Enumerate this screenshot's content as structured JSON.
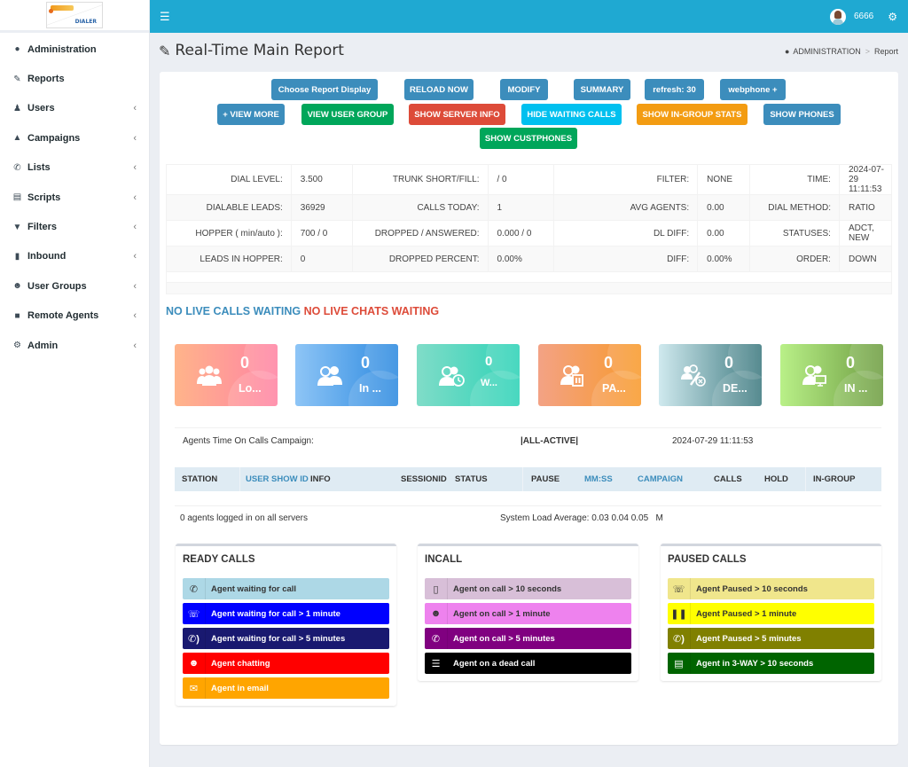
{
  "app": {
    "logo_text": "DIALER",
    "user": "6666"
  },
  "sidebar": {
    "items": [
      {
        "label": "Administration",
        "icon": "dashboard-icon",
        "has_submenu": false
      },
      {
        "label": "Reports",
        "icon": "edit-icon",
        "has_submenu": false
      },
      {
        "label": "Users",
        "icon": "user-icon",
        "has_submenu": true
      },
      {
        "label": "Campaigns",
        "icon": "bullhorn-icon",
        "has_submenu": true
      },
      {
        "label": "Lists",
        "icon": "phone-icon",
        "has_submenu": true
      },
      {
        "label": "Scripts",
        "icon": "file-text-icon",
        "has_submenu": true
      },
      {
        "label": "Filters",
        "icon": "filter-icon",
        "has_submenu": true
      },
      {
        "label": "Inbound",
        "icon": "bar-chart-icon",
        "has_submenu": true
      },
      {
        "label": "User Groups",
        "icon": "users-icon",
        "has_submenu": true
      },
      {
        "label": "Remote Agents",
        "icon": "lock-icon",
        "has_submenu": true
      },
      {
        "label": "Admin",
        "icon": "cog-icon",
        "has_submenu": true
      }
    ]
  },
  "header": {
    "title": "Real-Time Main Report",
    "breadcrumb": [
      "ADMINISTRATION",
      "Report"
    ]
  },
  "buttons": {
    "choose_report": "Choose Report Display",
    "reload": "RELOAD NOW",
    "modify": "MODIFY",
    "summary": "SUMMARY",
    "refresh": "refresh: 30",
    "webphone": "webphone +",
    "view_more": "+ VIEW MORE",
    "view_user_group": "VIEW USER GROUP",
    "show_server_info": "SHOW SERVER INFO",
    "hide_waiting_calls": "HIDE WAITING CALLS",
    "show_ingroup_stats": "SHOW IN-GROUP STATS",
    "show_phones": "SHOW PHONES",
    "show_custphones": "SHOW CUSTPHONES"
  },
  "stats": {
    "rows": [
      [
        {
          "k": "DIAL LEVEL:",
          "v": "3.500"
        },
        {
          "k": "TRUNK SHORT/FILL:",
          "v": "/ 0"
        },
        {
          "k": "FILTER:",
          "v": "NONE"
        },
        {
          "k": "TIME:",
          "v": "2024-07-29 11:11:53"
        }
      ],
      [
        {
          "k": "DIALABLE LEADS:",
          "v": "36929"
        },
        {
          "k": "CALLS TODAY:",
          "v": "1"
        },
        {
          "k": "AVG AGENTS:",
          "v": "0.00"
        },
        {
          "k": "DIAL METHOD:",
          "v": "RATIO"
        }
      ],
      [
        {
          "k": "HOPPER ( min/auto ):",
          "v": "700 / 0"
        },
        {
          "k": "DROPPED / ANSWERED:",
          "v": "0.000 / 0"
        },
        {
          "k": "DL DIFF:",
          "v": "0.00"
        },
        {
          "k": "STATUSES:",
          "v": "ADCT, NEW"
        }
      ],
      [
        {
          "k": "LEADS IN HOPPER:",
          "v": "0"
        },
        {
          "k": "DROPPED PERCENT:",
          "v": "0.00%"
        },
        {
          "k": "DIFF:",
          "v": "0.00%"
        },
        {
          "k": "ORDER:",
          "v": "DOWN"
        }
      ]
    ]
  },
  "waiting": {
    "calls": "NO LIVE CALLS WAITING",
    "chats": "NO LIVE CHATS WAITING"
  },
  "cards": [
    {
      "count": "0",
      "label": "Lo...",
      "icon": "users-group-icon",
      "gradient": [
        "#ffb48a",
        "#ff84a4"
      ]
    },
    {
      "count": "0",
      "label": "In ...",
      "icon": "headset-agents-icon",
      "gradient": [
        "#8ec5f6",
        "#2d8ae0"
      ]
    },
    {
      "count": "0",
      "label": "W...",
      "icon": "agents-clock-icon",
      "gradient": [
        "#80dcc8",
        "#2ed3b7"
      ]
    },
    {
      "count": "0",
      "label": "PA...",
      "icon": "agents-pause-icon",
      "gradient": [
        "#f3a285",
        "#f89a2c"
      ]
    },
    {
      "count": "0",
      "label": "DE...",
      "icon": "agents-dead-icon",
      "gradient": [
        "#cfe9ee",
        "#3e7a80"
      ]
    },
    {
      "count": "0",
      "label": "IN ...",
      "icon": "agents-monitor-icon",
      "gradient": [
        "#b9f088",
        "#6e9d42"
      ]
    }
  ],
  "agent_time": {
    "label": "Agents Time On Calls Campaign:",
    "campaign": "|ALL-ACTIVE|",
    "time": "2024-07-29 11:11:53"
  },
  "agent_table": {
    "columns": [
      "STATION",
      "USER SHOW ID",
      "INFO",
      "SESSIONID",
      "STATUS",
      "PAUSE",
      "MM:SS",
      "CAMPAIGN",
      "CALLS",
      "HOLD",
      "IN-GROUP"
    ],
    "rows": []
  },
  "footer": {
    "agents_logged": "0 agents logged in on all servers",
    "load_average": "System Load Average: 0.03 0.04 0.05   M"
  },
  "legend": {
    "ready": {
      "title": "READY CALLS",
      "items": [
        {
          "label": "Agent waiting for call",
          "bg": "#add8e6",
          "fg": "#333333"
        },
        {
          "label": "Agent waiting for call > 1 minute",
          "bg": "#0000ff",
          "fg": "#ffffff"
        },
        {
          "label": "Agent waiting for call > 5 minutes",
          "bg": "#191970",
          "fg": "#ffffff"
        },
        {
          "label": "Agent chatting",
          "bg": "#ff0000",
          "fg": "#ffffff"
        },
        {
          "label": "Agent in email",
          "bg": "#ffa500",
          "fg": "#ffffff"
        }
      ]
    },
    "incall": {
      "title": "INCALL",
      "items": [
        {
          "label": "Agent on call > 10 seconds",
          "bg": "#d8bfd8",
          "fg": "#333333"
        },
        {
          "label": "Agent on call > 1 minute",
          "bg": "#ee82ee",
          "fg": "#333333"
        },
        {
          "label": "Agent on call > 5 minutes",
          "bg": "#800080",
          "fg": "#ffffff"
        },
        {
          "label": "Agent on a dead call",
          "bg": "#000000",
          "fg": "#ffffff"
        }
      ]
    },
    "paused": {
      "title": "PAUSED CALLS",
      "items": [
        {
          "label": "Agent Paused > 10 seconds",
          "bg": "#f0e68c",
          "fg": "#333333"
        },
        {
          "label": "Agent Paused > 1 minute",
          "bg": "#ffff00",
          "fg": "#333333"
        },
        {
          "label": "Agent Paused > 5 minutes",
          "bg": "#808000",
          "fg": "#ffffff"
        },
        {
          "label": "Agent in 3-WAY > 10 seconds",
          "bg": "#006400",
          "fg": "#ffffff"
        }
      ]
    }
  }
}
